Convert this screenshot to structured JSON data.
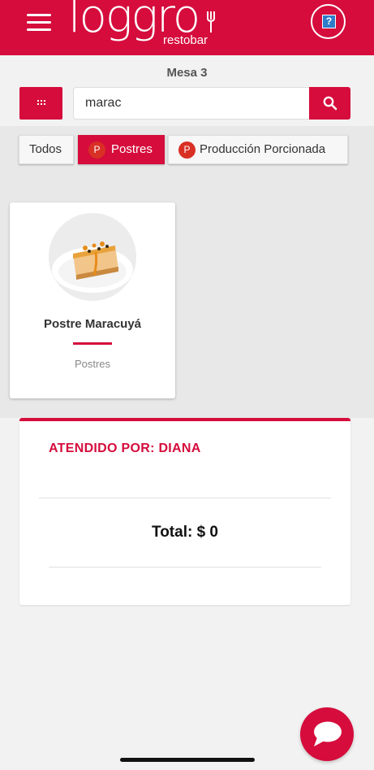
{
  "header": {
    "logo_text": "loggro",
    "logo_sub": "restobar",
    "menu_icon": "hamburger-menu-icon",
    "help_icon": "help-question-icon"
  },
  "table_label": "Mesa 3",
  "search": {
    "value": "marac",
    "grid_icon": "grid-icon",
    "search_icon": "search-icon"
  },
  "categories": [
    {
      "label": "Todos",
      "badge": "",
      "active": false
    },
    {
      "label": "Postres",
      "badge": "P",
      "active": true
    },
    {
      "label": "Producción Porcionada",
      "badge": "P",
      "active": false
    }
  ],
  "products": [
    {
      "name": "Postre Maracuyá",
      "category": "Postres",
      "image": "passion-fruit-cheesecake-photo"
    }
  ],
  "order": {
    "attended_by": "ATENDIDO POR: DIANA",
    "total": "Total: $ 0"
  },
  "chat_icon": "chat-bubble-icon",
  "colors": {
    "brand": "#d50c3c",
    "background": "#f2f2f2",
    "category_bar": "#e8e8e8"
  }
}
